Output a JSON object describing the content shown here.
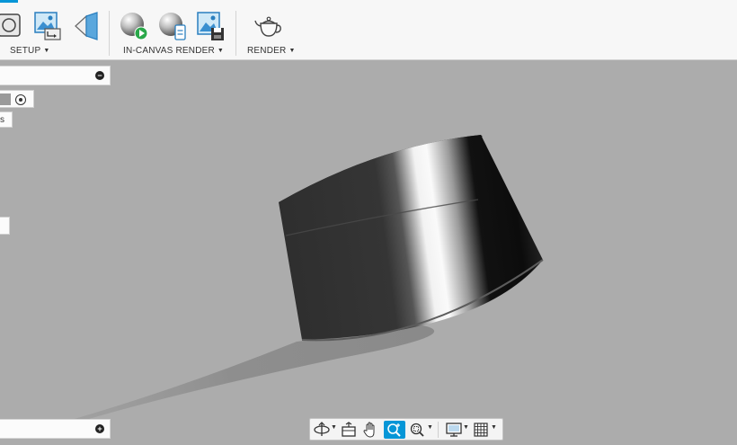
{
  "toolbar": {
    "groups": [
      {
        "label": "SETUP",
        "caret": "▼"
      },
      {
        "label": "IN-CANVAS RENDER",
        "caret": "▼"
      },
      {
        "label": "RENDER",
        "caret": "▼"
      }
    ],
    "tools": [
      {
        "icon": "scene-settings-icon"
      },
      {
        "icon": "environment-image-icon"
      },
      {
        "icon": "decal-icon"
      },
      {
        "icon": "in-canvas-render-start-icon"
      },
      {
        "icon": "in-canvas-render-settings-icon"
      },
      {
        "icon": "capture-image-icon"
      },
      {
        "icon": "render-teapot-icon"
      }
    ]
  },
  "browser_panel": {
    "top_toggle": "−",
    "bottom_toggle": "+",
    "chip_text": "s"
  },
  "navbar": {
    "tools": [
      {
        "icon": "orbit-icon"
      },
      {
        "icon": "look-at-icon"
      },
      {
        "icon": "pan-icon"
      },
      {
        "icon": "zoom-icon",
        "active": true
      },
      {
        "icon": "fit-icon"
      },
      {
        "icon": "display-settings-icon"
      },
      {
        "icon": "grid-icon"
      }
    ]
  },
  "colors": {
    "accent": "#0696d7",
    "canvas": "#acacac",
    "toolbar": "#f7f7f7"
  }
}
